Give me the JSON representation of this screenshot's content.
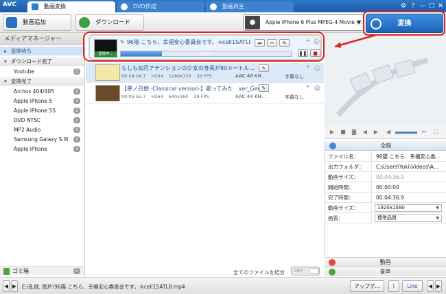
{
  "titlebar": {
    "logo": "AVC",
    "tabs": [
      {
        "label": "動画変換"
      },
      {
        "label": "DVD作成"
      },
      {
        "label": "動画再生"
      }
    ],
    "window_controls": [
      "⚙",
      "?",
      "—",
      "□",
      "✕"
    ]
  },
  "toolbar": {
    "add_label": "動画追加",
    "download_label": "ダウンロード",
    "profile": "Apple iPhone 6 Plus MPEG-4 Movie (*...",
    "convert_label": "変換"
  },
  "sidebar": {
    "title": "メディアマネージャー",
    "items": [
      {
        "label": "変換待ち",
        "kind": "head-active"
      },
      {
        "label": "ダウンロード完了",
        "kind": "head"
      },
      {
        "label": "Youtube",
        "count": "1"
      },
      {
        "label": "変換完了",
        "kind": "head"
      },
      {
        "label": "Archos 404/405",
        "count": "1"
      },
      {
        "label": "Apple iPhone 5",
        "count": "1"
      },
      {
        "label": "Apple iPhone 5S",
        "count": "1"
      },
      {
        "label": "DVD NTSC",
        "count": "1"
      },
      {
        "label": "MP2 Audio",
        "count": "1"
      },
      {
        "label": "Samsung Galaxy S III",
        "count": "1"
      },
      {
        "label": "Apple iPhone",
        "count": "2"
      }
    ],
    "trash_label": "ゴミ箱",
    "trash_count": "5"
  },
  "tasks": [
    {
      "title": "96猫 こちら、幸福安心委員会です。-kcell1SATL8",
      "thumb_label": "変換中...",
      "progress_text": "24%",
      "progress": 0.24
    },
    {
      "title": "もしも如月アテンションの少女の身長が80メートル...",
      "duration": "00:04:04.7",
      "codec": "H264",
      "resolution": "1280x720",
      "fps": "30 FPS",
      "audio": "AAC 48 KH...",
      "subtitle": "字幕なし"
    },
    {
      "title": "【悪ノ召使 -Classical version-】歌ってみた　ver_Ger...",
      "duration": "00:05:55.7",
      "codec": "H264",
      "resolution": "640x360",
      "fps": "29 FPS",
      "audio": "AAC 44 KH...",
      "subtitle": "字幕なし"
    }
  ],
  "merge": {
    "label": "全てのファイルを結合",
    "toggle": "OFF"
  },
  "props": {
    "header": "全般",
    "rows": [
      {
        "key": "ファイル名：",
        "value": "96猫 こちら、幸福安心委..."
      },
      {
        "key": "出力フォルダ：",
        "value": "C:\\Users\\Yuki\\Videos\\A..."
      },
      {
        "key": "動画サイズ：",
        "value": "00:04:36.9"
      },
      {
        "key": "開始時間：",
        "value": "00:00:00"
      },
      {
        "key": "完了時間：",
        "value": "00:04:36.9"
      },
      {
        "key": "動画サイズ：",
        "value": "1920x1080"
      },
      {
        "key": "画質：",
        "value": "標準品質"
      }
    ]
  },
  "sections": {
    "video": "動画",
    "audio": "音声"
  },
  "statusbar": {
    "path": "E:\\乱视, 图片\\96猫 こちら、幸福安心委員会です。-kcell1SATL8.mp4",
    "upgrade": "アップグ...",
    "twitter": "t",
    "like": "Like"
  },
  "colors": {
    "accent": "#1d62b8",
    "titlebar": "#2f78c8",
    "annotation": "#d9251d"
  }
}
